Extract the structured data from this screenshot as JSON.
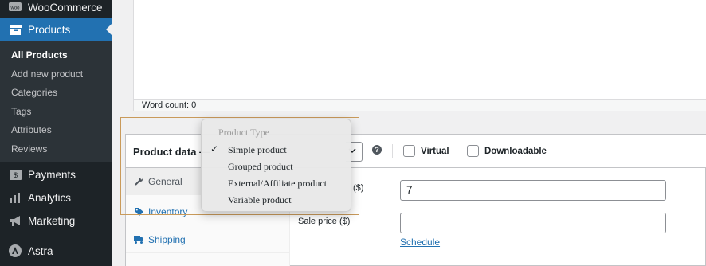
{
  "sidebar": {
    "top_items": [
      {
        "label": "WooCommerce",
        "icon": "woo-icon"
      },
      {
        "label": "Products",
        "icon": "products-box-icon"
      }
    ],
    "submenu": [
      "All Products",
      "Add new product",
      "Categories",
      "Tags",
      "Attributes",
      "Reviews"
    ],
    "bottom_items": [
      {
        "label": "Payments",
        "icon": "payments-icon"
      },
      {
        "label": "Analytics",
        "icon": "analytics-bar-icon"
      },
      {
        "label": "Marketing",
        "icon": "megaphone-icon"
      },
      {
        "label": "Astra",
        "icon": "astra-logo-icon"
      }
    ],
    "accent_color": "#2271b1"
  },
  "editor": {
    "word_count": "Word count: 0"
  },
  "product_data": {
    "title": "Product data —",
    "help_icon_glyph": "?",
    "virtual_label": "Virtual",
    "downloadable_label": "Downloadable",
    "tabs": [
      {
        "label": "General",
        "icon": "wrench-icon"
      },
      {
        "label": "Inventory",
        "icon": "tag-icon"
      },
      {
        "label": "Shipping",
        "icon": "truck-icon"
      }
    ],
    "regular_price_label_suffix": "($)",
    "regular_price_value": "7",
    "sale_price_label": "Sale price ($)",
    "sale_price_value": "",
    "schedule_link": "Schedule"
  },
  "product_type_dropdown": {
    "header": "Product Type",
    "selected": "Simple product",
    "options": [
      "Simple product",
      "Grouped product",
      "External/Affiliate product",
      "Variable product"
    ],
    "check_glyph": "✓"
  },
  "colors": {
    "highlight_border": "#c99a5a",
    "link": "#2271b1",
    "sidebar_bg": "#1d2327"
  }
}
